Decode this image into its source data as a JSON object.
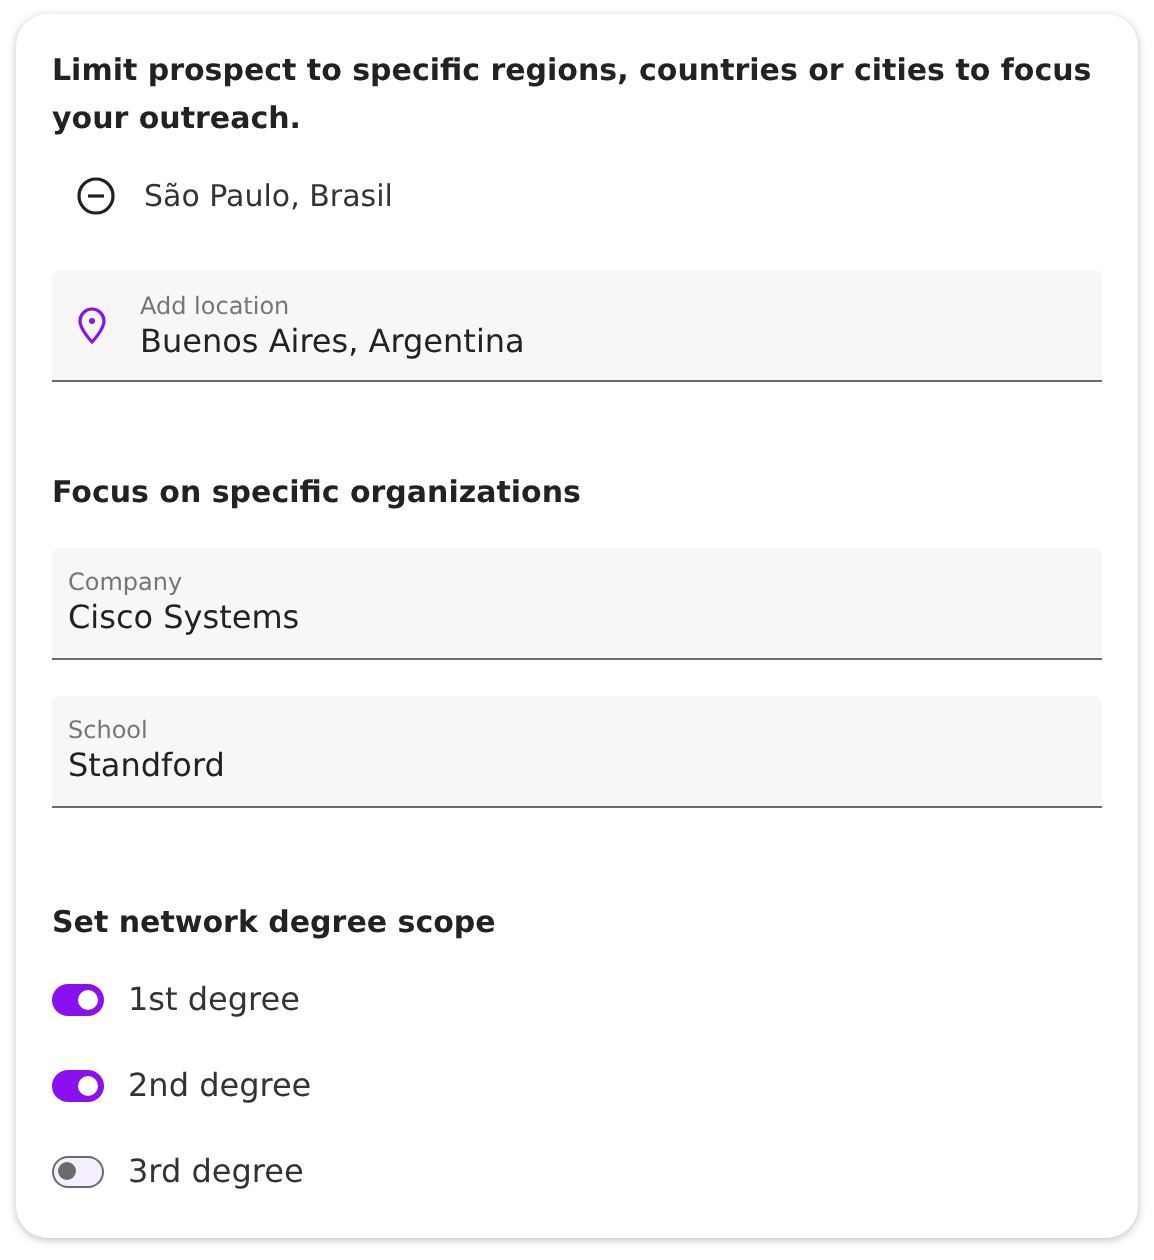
{
  "locations": {
    "heading": "Limit prospect to specific regions, countries or cities to focus your outreach.",
    "items": [
      {
        "label": "São Paulo, Brasil"
      }
    ],
    "add_field": {
      "label": "Add location",
      "value": "Buenos Aires, Argentina"
    }
  },
  "organizations": {
    "heading": "Focus on specific organizations",
    "fields": [
      {
        "label": "Company",
        "value": "Cisco Systems"
      },
      {
        "label": "School",
        "value": "Standford"
      }
    ]
  },
  "network": {
    "heading": "Set network degree scope",
    "toggles": [
      {
        "label": "1st degree",
        "on": true
      },
      {
        "label": "2nd degree",
        "on": true
      },
      {
        "label": "3rd degree",
        "on": false
      }
    ]
  }
}
